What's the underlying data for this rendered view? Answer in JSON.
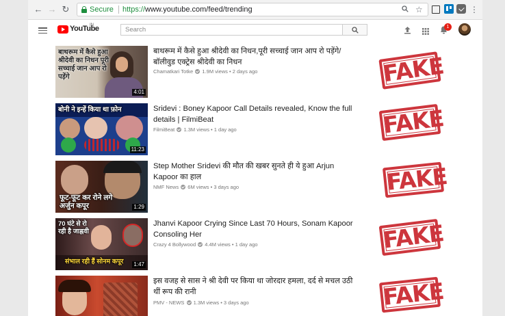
{
  "browser": {
    "secure_label": "Secure",
    "url_scheme": "https://",
    "url_rest": "www.youtube.com/feed/trending",
    "notification_count": "1"
  },
  "youtube": {
    "logo_text": "YouTube",
    "region": "IN",
    "search_placeholder": "Search"
  },
  "stamp_text": "FAKE",
  "videos": [
    {
      "thumb_text": "बाथरूम में कैसे हुआ श्रीदेवी का निधन पूरी सच्चाई जान आप रो पड़ेंगे",
      "duration": "4:01",
      "title": "बाथरूम में कैसे हुआ श्रीदेवी का निधन,पूरी सच्चाई जान आप रो पड़ेंगे/बॉलीवुड एक्ट्रेस श्रीदेवी का निधन",
      "channel": "Chamatkari Totke",
      "views": "1.9M views",
      "age": "2 days ago"
    },
    {
      "thumb_text": "बोनी ने इन्हें किया था फ़ोन",
      "duration": "11:23",
      "title": "Sridevi : Boney Kapoor Call Details revealed, Know the full details | FilmiBeat",
      "channel": "FilmiBeat",
      "views": "1.3M views",
      "age": "1 day ago"
    },
    {
      "thumb_text": "फूट-फूट कर रोने लगे अर्जुन कपूर",
      "duration": "1:29",
      "title": "Step Mother Sridevi की मौत की खबर सुनते ही ये हुआ Arjun Kapoor का हाल",
      "channel": "NMF News",
      "views": "6M views",
      "age": "3 days ago"
    },
    {
      "thumb_text": "70 घंटे से रो रही है जाह्नवी",
      "thumb_text2": "संभाल रही हैं सोनम कपूर",
      "duration": "1:47",
      "title": "Jhanvi Kapoor Crying Since Last 70 Hours, Sonam Kapoor Consoling Her",
      "channel": "Crazy 4 Bollywood",
      "views": "4.4M views",
      "age": "1 day ago"
    },
    {
      "duration": "",
      "title": "इस वजह से सास ने श्री देवी पर किया था जोरदार हमला, दर्द से मचल उठी थीं रूप की रानी",
      "channel": "PMV - NEWS",
      "views": "1.3M views",
      "age": "3 days ago"
    }
  ]
}
